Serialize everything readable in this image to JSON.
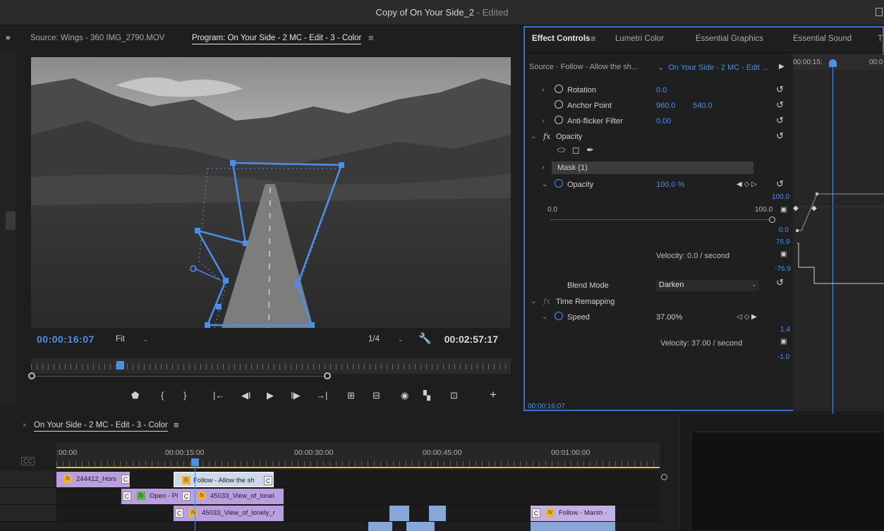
{
  "window": {
    "title": "Copy of On Your Side_2",
    "edited": " - Edited"
  },
  "monitor": {
    "collapse_label": "»",
    "source_tab": "Source: Wings - 360 IMG_2790.MOV",
    "program_tab": "Program: On Your Side - 2 MC  - Edit - 3 - Color",
    "menu_icon": "≡",
    "current_tc": "00:00:16:07",
    "fit_label": "Fit",
    "resolution": "1/4",
    "duration_tc": "00:02:57:17"
  },
  "effect_controls": {
    "tabs": [
      "Effect Controls",
      "Lumetri Color",
      "Essential Graphics",
      "Essential Sound",
      "T"
    ],
    "menu_icon": "≡",
    "source": "Source · Follow - Allow the sh...",
    "sequence": "On Your Side - 2 MC  - Edit ...",
    "ruler_labels": [
      "00:00:15:",
      "00:0"
    ],
    "rotation": {
      "name": "Rotation",
      "value": "0.0"
    },
    "anchor": {
      "name": "Anchor Point",
      "x": "960.0",
      "y": "540.0"
    },
    "antiflicker": {
      "name": "Anti-flicker Filter",
      "value": "0.00"
    },
    "opacity_section": "Opacity",
    "mask": "Mask (1)",
    "opacity": {
      "name": "Opacity",
      "value": "100.0 %"
    },
    "graph_values": {
      "top": "100.0",
      "zero_left": "0.0",
      "hundred_right": "100.0",
      "zero_right": "0.0",
      "vel_top": "76.9",
      "vel_bottom": "-76.9",
      "velocity": "Velocity: 0.0 / second"
    },
    "blend_mode": {
      "label": "Blend Mode",
      "value": "Darken"
    },
    "time_remap": "Time Remapping",
    "speed": {
      "name": "Speed",
      "value": "37.00%"
    },
    "speed_graph": {
      "top": "1.4",
      "bottom": "-1.0",
      "velocity": "Velocity: 37.00 / second"
    },
    "footer_tc": "00:00:16:07"
  },
  "timeline": {
    "tab": "On Your Side - 2 MC  - Edit - 3 - Color",
    "close_icon": "×",
    "menu_icon": "≡",
    "cc_label": "CC",
    "ruler": [
      ":00:00",
      "00:00:15:00",
      "00:00:30:00",
      "00:00:45:00",
      "00:01:00:00"
    ],
    "clips": {
      "c1": "244412_Hors",
      "c2": "Follow - Allow the sh",
      "c3": "Open - Pl",
      "c4": "45033_View_of_lonel",
      "c5": "45033_View_of_lonely_r",
      "c6": "Follow - Marsh -",
      "fx": "fx",
      "c": "C"
    }
  },
  "colors": {
    "accent": "#4d8fe8",
    "clip_purple": "#b99fe0",
    "fx_badge": "#e9b23c",
    "work_area": "#d9c734"
  }
}
